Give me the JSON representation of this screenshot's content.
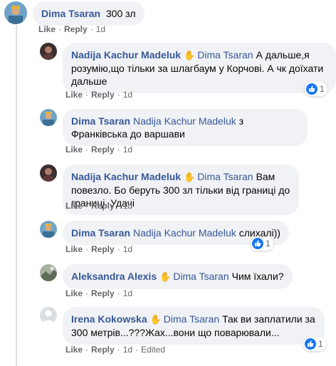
{
  "comments": [
    {
      "author": "Dima Tsaran",
      "tag": "",
      "text": "300 зл",
      "actions": [
        "Like",
        "Reply"
      ],
      "time": "1d",
      "edited": "",
      "reactions": ""
    },
    {
      "author": "Nadija Kachur Madeluk",
      "tag": "Dima Tsaran",
      "text": "А дальше,я розумію,що тільки за шлагбаум у Корчові. А чк доїхати дальше",
      "actions": [
        "Like",
        "Reply"
      ],
      "time": "1d",
      "edited": "",
      "reactions": "1"
    },
    {
      "author": "Dima Tsaran",
      "tag": "Nadija Kachur Madeluk",
      "text": "з Франківська до варшави",
      "actions": [
        "Like",
        "Reply"
      ],
      "time": "1d",
      "edited": "",
      "reactions": ""
    },
    {
      "author": "Nadija Kachur Madeluk",
      "tag": "Dima Tsaran",
      "text": "Вам повезло. Бо беруть 300 зл тільки від границі до границі. Удачі",
      "actions": [
        "Like",
        "Reply"
      ],
      "time": "1d",
      "edited": "",
      "reactions": ""
    },
    {
      "author": "Dima Tsaran",
      "tag": "Nadija Kachur Madeluk",
      "text": "слихалі))",
      "actions": [
        "Like",
        "Reply"
      ],
      "time": "1d",
      "edited": "",
      "reactions": "1"
    },
    {
      "author": "Aleksandra Alexis",
      "tag": "Dima Tsaran",
      "text": "Чим їхали?",
      "actions": [
        "Like",
        "Reply"
      ],
      "time": "1d",
      "edited": "",
      "reactions": ""
    },
    {
      "author": "Irena Kokowska",
      "tag": "Dima Tsaran",
      "text": "Так ви заплатили за 300 метрів...???Жах...вони що поварювали...",
      "actions": [
        "Like",
        "Reply"
      ],
      "time": "1d",
      "edited": "Edited",
      "reactions": "1"
    }
  ],
  "colors": {
    "link": "#385898",
    "bubble": "#f0f2f5",
    "like_blue": "#1877f2",
    "meta": "#65676b"
  }
}
